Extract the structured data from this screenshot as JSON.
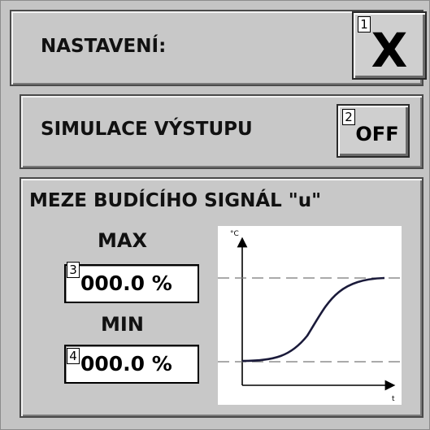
{
  "settings": {
    "title": "NASTAVENÍ:",
    "close_label": "X",
    "close_badge": "1"
  },
  "simulation": {
    "label": "SIMULACE VÝSTUPU",
    "toggle_label": "OFF",
    "toggle_badge": "2"
  },
  "limits": {
    "title": "MEZE BUDÍCÍHO SIGNÁL \"u\"",
    "max_label": "MAX",
    "max_value": "000.0 %",
    "max_badge": "3",
    "min_label": "MIN",
    "min_value": "000.0 %",
    "min_badge": "4"
  },
  "graph": {
    "y_unit": "°C",
    "x_unit": "t"
  }
}
